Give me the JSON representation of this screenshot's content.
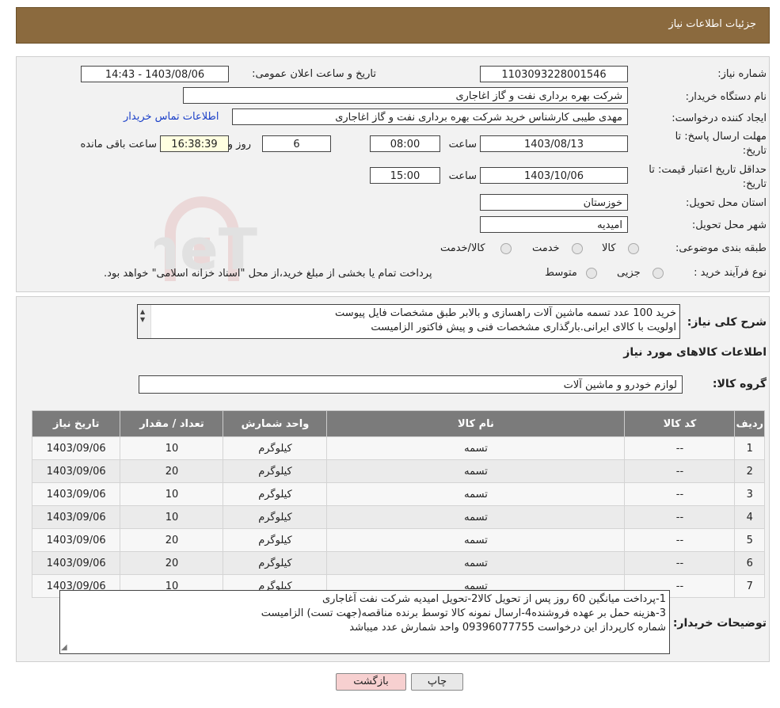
{
  "header": {
    "title": "جزئیات اطلاعات نیاز"
  },
  "details": {
    "need_number_label": "شماره نیاز:",
    "need_number": "1103093228001546",
    "announce_label": "تاریخ و ساعت اعلان عمومی:",
    "announce_value": "1403/08/06 - 14:43",
    "buyer_org_label": "نام دستگاه خریدار:",
    "buyer_org": "شرکت بهره برداری نفت و گاز اغاجاری",
    "creator_label": "ایجاد کننده درخواست:",
    "creator": "مهدی طیبی کارشناس خرید شرکت بهره برداری نفت و گاز اغاجاری",
    "contact_link": "اطلاعات تماس خریدار",
    "deadline_label_1": "مهلت ارسال پاسخ: تا",
    "deadline_label_2": "تاریخ:",
    "deadline_date": "1403/08/13",
    "time_label": "ساعت",
    "deadline_time": "08:00",
    "days_value": "6",
    "days_label": "روز و",
    "remaining_value": "16:38:39",
    "remaining_label": "ساعت باقی مانده",
    "validity_label_1": "حداقل تاریخ اعتبار قیمت: تا",
    "validity_label_2": "تاریخ:",
    "validity_date": "1403/10/06",
    "validity_time": "15:00",
    "province_label": "استان محل تحویل:",
    "province": "خوزستان",
    "city_label": "شهر محل تحویل:",
    "city": "امیدیه",
    "category_label": "طبقه بندی موضوعی:",
    "category_options": [
      "کالا",
      "خدمت",
      "کالا/خدمت"
    ],
    "process_label": "نوع فرآیند خرید :",
    "process_options": [
      "جزیی",
      "متوسط"
    ],
    "process_note": "پرداخت تمام یا بخشی از مبلغ خرید،از محل \"اسناد خزانه اسلامی\" خواهد بود."
  },
  "description": {
    "label": "شرح کلی نیاز:",
    "lines": [
      "خرید 100 عدد تسمه ماشین آلات راهسازی و بالابر طبق مشخصات فایل پیوست",
      "اولویت با کالای ایرانی.بارگذاری مشخصات فنی و پیش فاکتور الزامیست"
    ]
  },
  "goods_section": {
    "title": "اطلاعات کالاهای مورد نیاز",
    "group_label": "گروه کالا:",
    "group_value": "لوازم خودرو و ماشین آلات"
  },
  "table": {
    "headers": [
      "ردیف",
      "کد کالا",
      "نام کالا",
      "واحد شمارش",
      "تعداد / مقدار",
      "تاریخ نیاز"
    ],
    "rows": [
      [
        "1",
        "--",
        "تسمه",
        "کیلوگرم",
        "10",
        "1403/09/06"
      ],
      [
        "2",
        "--",
        "تسمه",
        "کیلوگرم",
        "20",
        "1403/09/06"
      ],
      [
        "3",
        "--",
        "تسمه",
        "کیلوگرم",
        "10",
        "1403/09/06"
      ],
      [
        "4",
        "--",
        "تسمه",
        "کیلوگرم",
        "10",
        "1403/09/06"
      ],
      [
        "5",
        "--",
        "تسمه",
        "کیلوگرم",
        "20",
        "1403/09/06"
      ],
      [
        "6",
        "--",
        "تسمه",
        "کیلوگرم",
        "20",
        "1403/09/06"
      ],
      [
        "7",
        "--",
        "تسمه",
        "کیلوگرم",
        "10",
        "1403/09/06"
      ]
    ]
  },
  "buyer_notes": {
    "label": "توضیحات خریدار:",
    "lines": [
      "1-پرداخت میانگین 60 روز پس از تحویل کالا2-تحویل امیدیه شرکت نفت آغاجاری",
      "3-هزینه حمل بر عهده فروشنده4-ارسال نمونه کالا توسط برنده مناقصه(جهت تست) الزامیست",
      "شماره کارپرداز این درخواست 09396077755 واحد شمارش عدد میباشد"
    ]
  },
  "buttons": {
    "print": "چاپ",
    "back": "بازگشت"
  },
  "watermark": {
    "text": "AriaTender.neT"
  }
}
